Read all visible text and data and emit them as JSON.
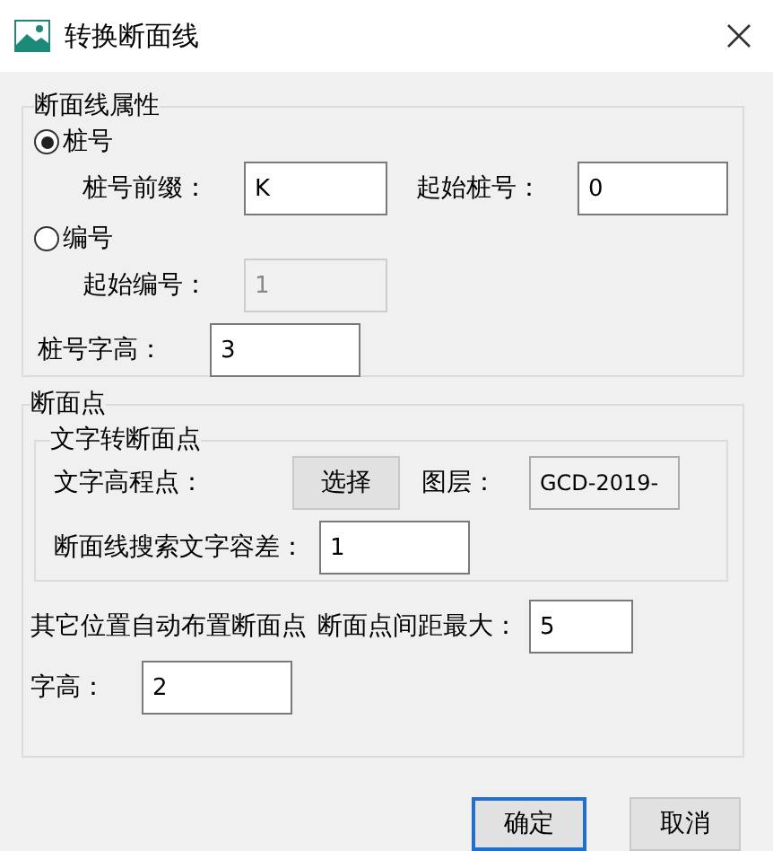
{
  "window": {
    "title": "转换断面线"
  },
  "section_line": {
    "legend": "断面线属性",
    "options": [
      {
        "label": "桩号",
        "selected": true,
        "fields": [
          {
            "label": "桩号前缀：",
            "value": "K",
            "disabled": false
          },
          {
            "label": "起始桩号：",
            "value": "0",
            "disabled": false
          }
        ]
      },
      {
        "label": "编号",
        "selected": false,
        "fields": [
          {
            "label": "起始编号：",
            "value": "1",
            "disabled": true
          }
        ]
      }
    ],
    "height_field": {
      "label": "桩号字高：",
      "value": "3"
    }
  },
  "section_points": {
    "legend": "断面点",
    "text_group": {
      "legend": "文字转断面点",
      "elevation_label": "文字高程点：",
      "select_button": "选择",
      "layer_label": "图层：",
      "layer_field": {
        "value": "GCD-2019-",
        "readonly": true
      },
      "tolerance": {
        "label": "断面线搜索文字容差：",
        "value": "1"
      }
    },
    "auto_label": "其它位置自动布置断面点",
    "max_spacing": {
      "label": "断面点间距最大：",
      "value": "5"
    },
    "text_height": {
      "label": "字高：",
      "value": "2"
    }
  },
  "buttons": [
    {
      "label": "确定",
      "default": true
    },
    {
      "label": "取消",
      "default": false
    }
  ]
}
